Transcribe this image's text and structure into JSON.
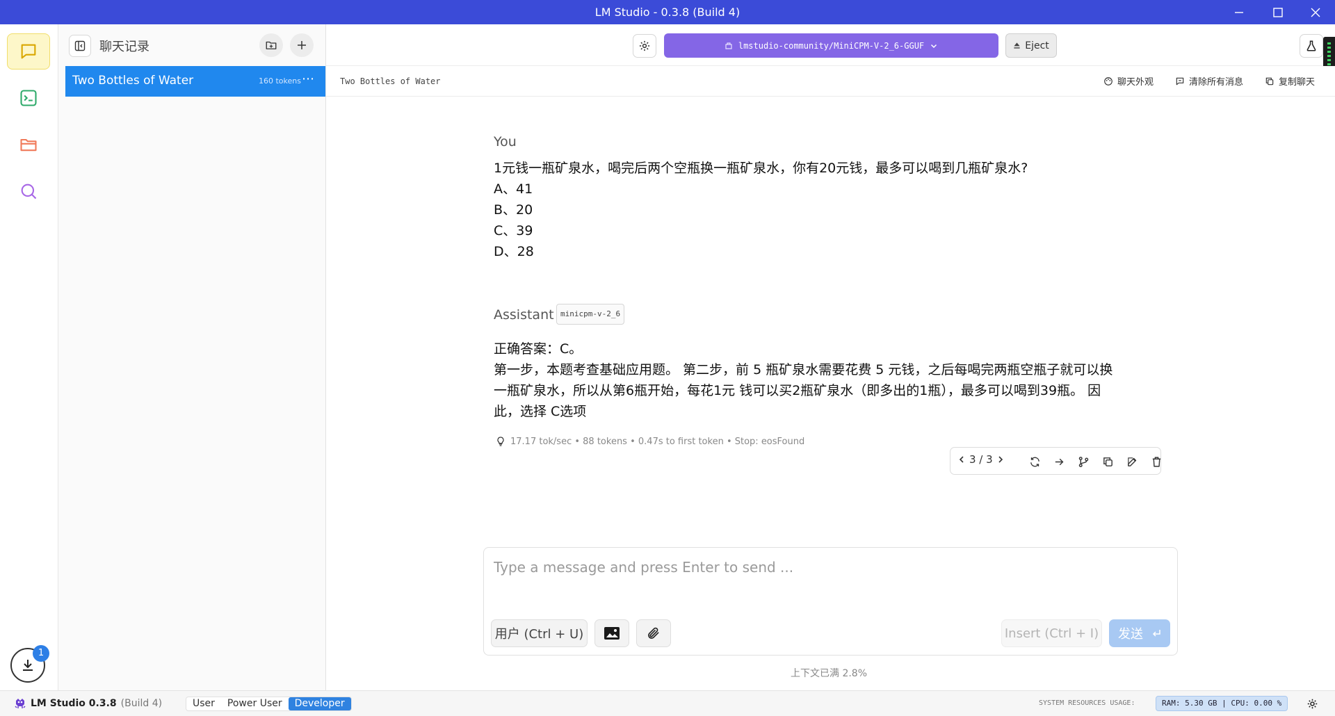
{
  "window": {
    "title": "LM Studio - 0.3.8 (Build 4)",
    "controls": [
      "minimize-icon",
      "maximize-icon",
      "close-icon"
    ]
  },
  "rail": {
    "items": [
      "chat-icon",
      "terminal-icon",
      "folder-icon",
      "search-icon"
    ],
    "active": "chat-icon",
    "downloads_badge": "1"
  },
  "sidebar": {
    "title": "聊天记录",
    "chats": [
      {
        "name": "Two Bottles of Water",
        "tokens": "160 tokens",
        "selected": true
      }
    ]
  },
  "toolbar": {
    "model": "lmstudio-community/MiniCPM-V-2_6-GGUF",
    "eject_label": "Eject"
  },
  "chat_header": {
    "title": "Two Bottles of Water",
    "actions": {
      "appearance": "聊天外观",
      "clear": "清除所有消息",
      "copy": "复制聊天"
    }
  },
  "messages": {
    "user": {
      "role": "You",
      "lines": [
        "1元钱一瓶矿泉水，喝完后两个空瓶换一瓶矿泉水，你有20元钱，最多可以喝到几瓶矿泉水?",
        "A、41",
        "B、20",
        "C、39",
        "D、28"
      ]
    },
    "assistant": {
      "role": "Assistant",
      "model_tag": "minicpm-v-2_6",
      "lines": [
        "正确答案：C。",
        "第一步，本题考查基础应用题。 第二步，前 5 瓶矿泉水需要花费 5 元钱，之后每喝完两瓶空瓶子就可以换",
        "一瓶矿泉水，所以从第6瓶开始，每花1元 钱可以买2瓶矿泉水（即多出的1瓶），最多可以喝到39瓶。 因",
        "此，选择 C选项"
      ],
      "stats": "17.17 tok/sec • 88 tokens • 0.47s to first token • Stop: eosFound",
      "pager": "3 / 3"
    }
  },
  "composer": {
    "placeholder": "Type a message and press Enter to send ...",
    "value": "",
    "role_button": "用户 (Ctrl + U)",
    "insert_button": "Insert (Ctrl + I)",
    "send_button": "发送",
    "context_usage": "上下文已满 2.8%"
  },
  "statusbar": {
    "app_name": "LM Studio 0.3.8",
    "build": "(Build 4)",
    "modes": [
      "User",
      "Power User",
      "Developer"
    ],
    "active_mode": "Developer",
    "system_label": "SYSTEM RESOURCES USAGE:",
    "resources": "RAM: 5.30 GB  |  CPU: 0.00 %"
  },
  "colors": {
    "titlebar": "#3b4bd8",
    "selected_chat": "#2088ee",
    "model_button": "#8466e6",
    "active_rail_bg": "#fdf7c9",
    "send_disabled": "#a8c9f3"
  }
}
